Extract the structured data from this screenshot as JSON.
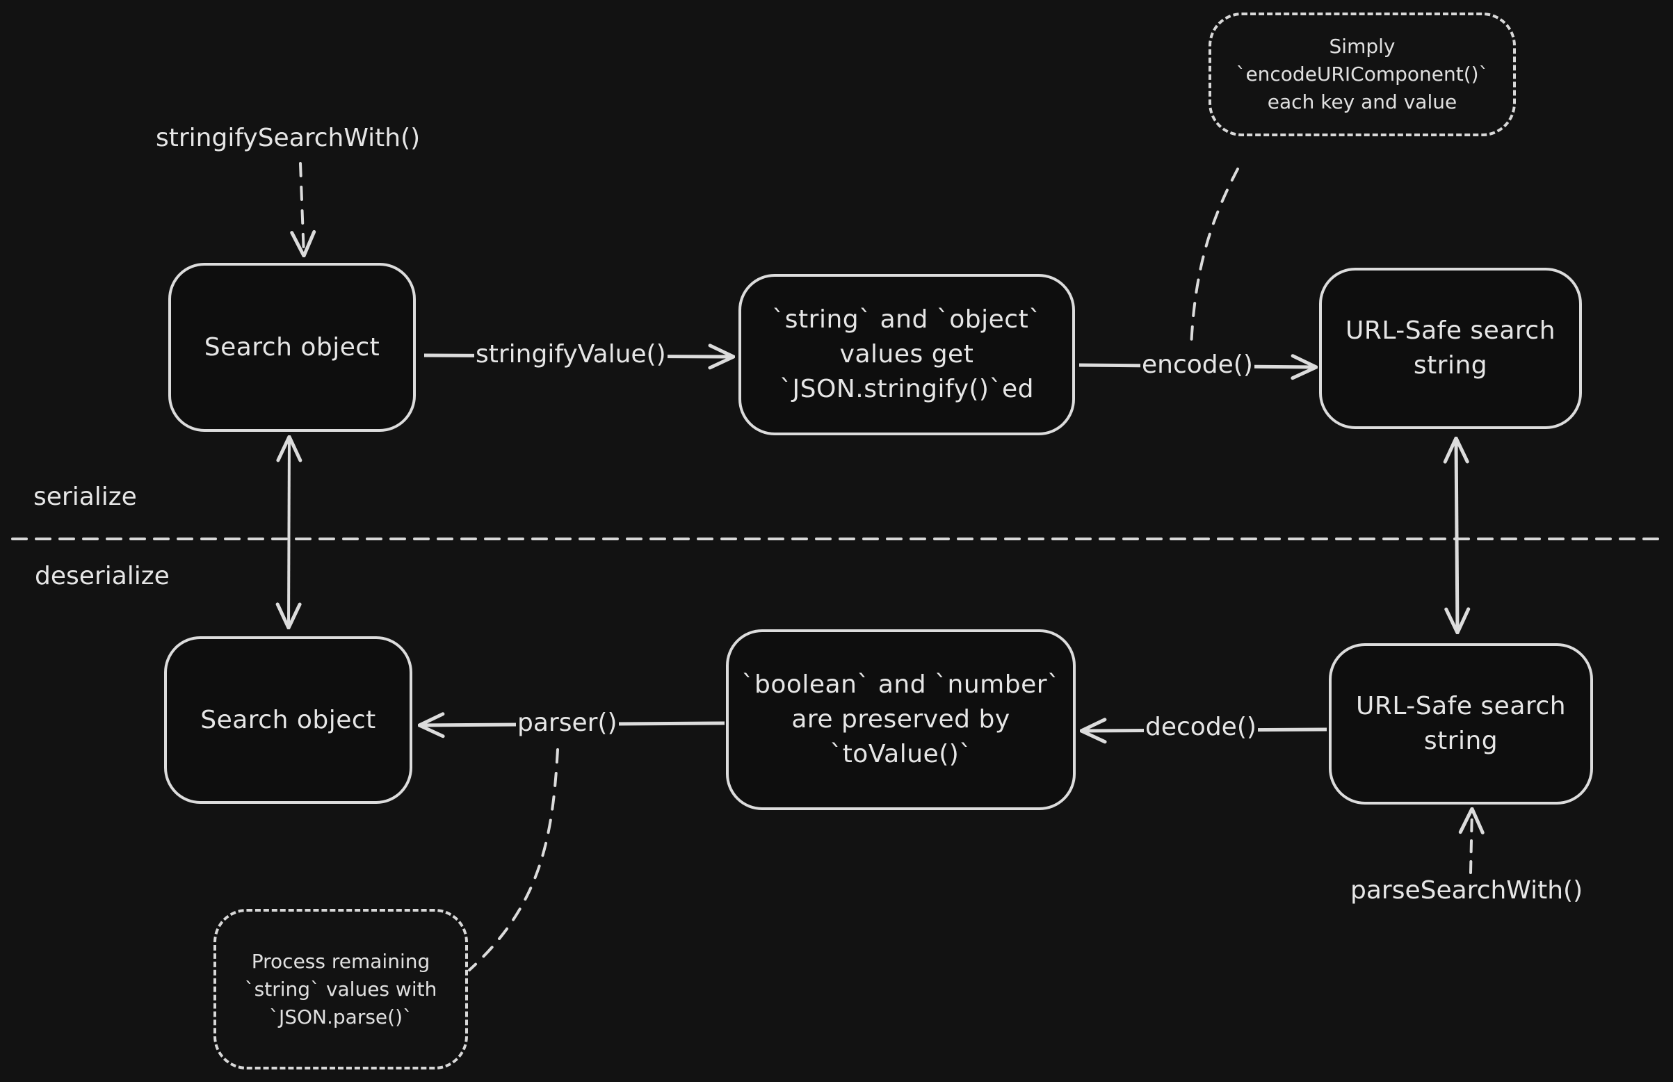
{
  "sections": {
    "serialize": "serialize",
    "deserialize": "deserialize"
  },
  "serialize_row": {
    "entry_label": "stringifySearchWith()",
    "search_object": "Search object",
    "stringify_value_edge": "stringifyValue()",
    "stringified_values": "`string` and `object`\nvalues get\n`JSON.stringify()`ed",
    "encode_edge": "encode()",
    "url_safe_string": "URL-Safe search\nstring",
    "encode_note": "Simply\n`encodeURIComponent()`\neach key and value"
  },
  "deserialize_row": {
    "search_object": "Search object",
    "parser_edge": "parser()",
    "preserved_values": "`boolean` and `number`\nare preserved by\n`toValue()`",
    "decode_edge": "decode()",
    "url_safe_string": "URL-Safe search\nstring",
    "entry_label": "parseSearchWith()",
    "parse_note": "Process remaining\n`string` values with\n`JSON.parse()`"
  },
  "colors": {
    "background": "#121212",
    "stroke": "#dcdcdc",
    "text": "#e6e6e6"
  }
}
